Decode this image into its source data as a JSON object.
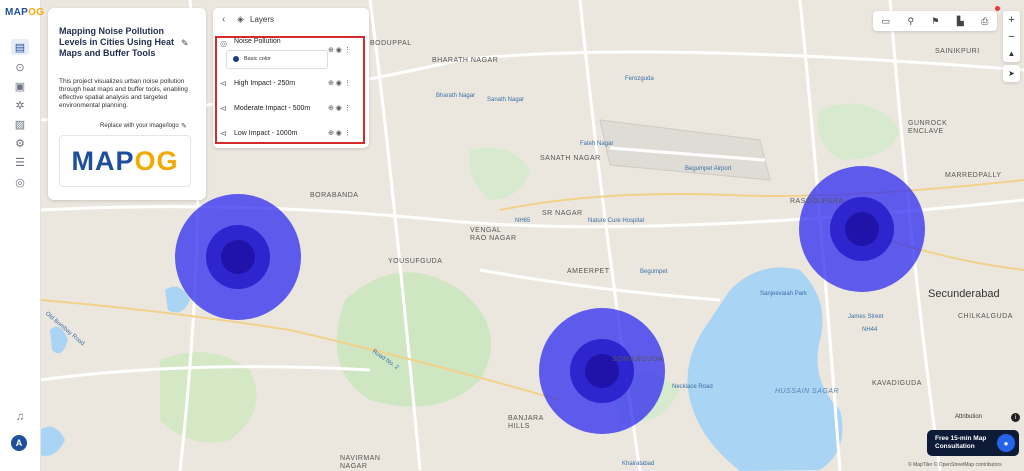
{
  "app": {
    "logo_main": "MAP",
    "logo_accent": "OG"
  },
  "sidebar": {
    "icons": [
      "map-icon",
      "location-pin-icon",
      "document-icon",
      "settings-cog-icon",
      "image-icon",
      "gear-icon",
      "report-icon",
      "globe-icon"
    ],
    "notification_icon": "bell-icon",
    "avatar_letter": "A"
  },
  "project": {
    "title": "Mapping Noise Pollution Levels in Cities Using Heat Maps and Buffer Tools",
    "description": "This project visualizes urban noise pollution through heat maps and buffer tools, enabling effective spatial analysis and targeted environmental planning.",
    "replace_logo_label": "Replace with your image/logo",
    "logo_main": "MAP",
    "logo_accent": "OG"
  },
  "layers": {
    "title": "Layers",
    "items": [
      {
        "name": "Noise Pollution",
        "legend": "Basic color"
      },
      {
        "name": "High Impact - 250m"
      },
      {
        "name": "Moderate Impact - 500m"
      },
      {
        "name": "Low Impact - 1000m"
      }
    ]
  },
  "map": {
    "labels": {
      "bharath_nagar": "BHARATH NAGAR",
      "boduppal": "BODUPPAL",
      "ferozguda": "Ferozguda",
      "bharath_nagar_stop": "Bharath Nagar",
      "sanath_nagar_stop": "Sanath Nagar",
      "fateh_nagar": "Fateh Nagar",
      "sanath_nagar": "SANATH NAGAR",
      "begumpet_airport": "Begumpet Airport",
      "borabanda": "BORABANDA",
      "sr_nagar": "SR NAGAR",
      "nature_cure": "Nature Cure Hospital",
      "vengal_rao_nagar": "VENGAL RAO NAGAR",
      "yousufguda": "YOUSUFGUDA",
      "ameerpet": "AMEERPET",
      "begumpet": "Begumpet",
      "old_bombay_road": "Old Bombay Road",
      "road_no_2": "Road No. 2",
      "sanjeevaiah_park": "Sanjeevaiah Park",
      "necklace_road": "Necklace Road",
      "somajiguda": "SOMAJIGUDA",
      "hussain_sagar": "Hussain Sagar",
      "banjara_hills": "BANJARA HILLS",
      "navirman_nagar": "NAVIRMAN NAGAR",
      "khairatabad": "Khairatabad",
      "kavadiguda": "KAVADIGUDA",
      "secunderabad": "Secunderabad",
      "james_street": "James Street",
      "chilkalguda": "CHILKALGUDA",
      "rasoolpura": "RASOOLPURA",
      "marredpally": "MARREDPALLY",
      "gunrock_enclave": "GUNROCK ENCLAVE",
      "sainikpuri": "SAINIKPURI",
      "nh_44": "NH44",
      "nh_65": "NH65"
    },
    "buffers_color": "#2f2bf0"
  },
  "toolbar": {
    "icons": [
      "measure-icon",
      "search-icon",
      "pin-icon",
      "building-icon",
      "print-icon",
      "close-icon"
    ]
  },
  "map_controls": {
    "zoom_in": "+",
    "zoom_out": "−",
    "compass": "▲",
    "locate": "➤"
  },
  "attribution": "Attribution",
  "cta": {
    "label": "Free 15-min Map Consultation"
  },
  "footer_credit": "© MapTiler © OpenStreetMap contributors"
}
